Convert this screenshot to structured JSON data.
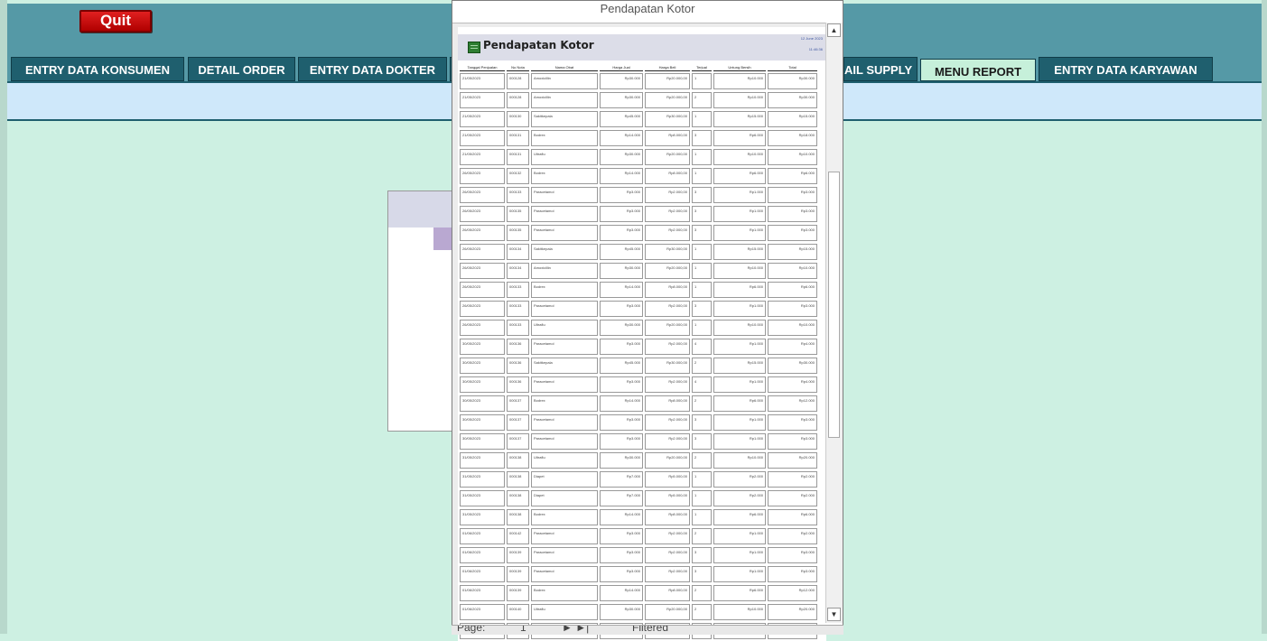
{
  "main": {
    "quit_label": "Quit",
    "tabs": [
      {
        "label": "ENTRY DATA KONSUMEN",
        "active": false
      },
      {
        "label": "DETAIL ORDER",
        "active": false
      },
      {
        "label": "ENTRY DATA DOKTER",
        "active": false
      },
      {
        "label": "",
        "active": false
      },
      {
        "label": "AIL SUPPLY",
        "active": false
      },
      {
        "label": "MENU REPORT",
        "active": true
      },
      {
        "label": "ENTRY DATA KARYAWAN",
        "active": false
      }
    ]
  },
  "report_window": {
    "title": "Pendapatan Kotor",
    "report_title": "Pendapatan Kotor",
    "date": "12 June 2023",
    "time": "11:46:36",
    "columns": [
      "Tanggal Penjualan",
      "No Nota",
      "Nama Obat",
      "Harga Jual",
      "Harga Beli",
      "Terjual",
      "Untung Bersih",
      "Total"
    ],
    "rows": [
      [
        "21/05/2023",
        "000128",
        "Amoxicillin",
        "Rp30.000",
        "Rp20.000,00",
        "1",
        "Rp10.000",
        "Rp30.000"
      ],
      [
        "21/05/2023",
        "000128",
        "Amoxicillin",
        "Rp30.000",
        "Rp20.000,00",
        "2",
        "Rp10.000",
        "Rp30.000"
      ],
      [
        "21/05/2023",
        "000130",
        "Sakitkepala",
        "Rp45.000",
        "Rp30.000,00",
        "1",
        "Rp15.000",
        "Rp15.000"
      ],
      [
        "21/05/2023",
        "000131",
        "Bodrex",
        "Rp14.000",
        "Rp8.000,00",
        "3",
        "Rp6.000",
        "Rp18.000"
      ],
      [
        "21/05/2023",
        "000131",
        "Ultraflu",
        "Rp30.000",
        "Rp20.000,00",
        "1",
        "Rp10.000",
        "Rp10.000"
      ],
      [
        "26/05/2023",
        "000132",
        "Bodrex",
        "Rp14.000",
        "Rp8.000,00",
        "1",
        "Rp6.000",
        "Rp6.000"
      ],
      [
        "26/05/2023",
        "000133",
        "Paracetamol",
        "Rp3.000",
        "Rp2.000,00",
        "3",
        "Rp1.000",
        "Rp3.000"
      ],
      [
        "26/05/2023",
        "000135",
        "Paracetamol",
        "Rp3.000",
        "Rp2.000,00",
        "3",
        "Rp1.000",
        "Rp3.000"
      ],
      [
        "26/05/2023",
        "000135",
        "Paracetamol",
        "Rp3.000",
        "Rp2.000,00",
        "3",
        "Rp1.000",
        "Rp3.000"
      ],
      [
        "26/05/2023",
        "000134",
        "Sakitkepala",
        "Rp45.000",
        "Rp30.000,00",
        "1",
        "Rp15.000",
        "Rp15.000"
      ],
      [
        "26/05/2023",
        "000134",
        "Amoxicillin",
        "Rp30.000",
        "Rp20.000,00",
        "1",
        "Rp10.000",
        "Rp10.000"
      ],
      [
        "26/05/2023",
        "000133",
        "Bodrex",
        "Rp14.000",
        "Rp8.000,00",
        "1",
        "Rp6.000",
        "Rp6.000"
      ],
      [
        "26/05/2023",
        "000133",
        "Paracetamol",
        "Rp3.000",
        "Rp2.000,00",
        "3",
        "Rp1.000",
        "Rp3.000"
      ],
      [
        "26/05/2023",
        "000133",
        "Ultraflu",
        "Rp30.000",
        "Rp20.000,00",
        "1",
        "Rp10.000",
        "Rp10.000"
      ],
      [
        "30/05/2023",
        "000136",
        "Paracetamol",
        "Rp3.000",
        "Rp2.000,00",
        "4",
        "Rp1.000",
        "Rp4.000"
      ],
      [
        "30/05/2023",
        "000136",
        "Sakitkepala",
        "Rp45.000",
        "Rp30.000,00",
        "2",
        "Rp15.000",
        "Rp30.000"
      ],
      [
        "30/05/2023",
        "000136",
        "Paracetamol",
        "Rp3.000",
        "Rp2.000,00",
        "4",
        "Rp1.000",
        "Rp4.000"
      ],
      [
        "30/05/2023",
        "000137",
        "Bodrex",
        "Rp14.000",
        "Rp8.000,00",
        "2",
        "Rp6.000",
        "Rp12.000"
      ],
      [
        "30/05/2023",
        "000137",
        "Paracetamol",
        "Rp3.000",
        "Rp2.000,00",
        "3",
        "Rp1.000",
        "Rp3.000"
      ],
      [
        "30/05/2023",
        "000137",
        "Paracetamol",
        "Rp3.000",
        "Rp2.000,00",
        "3",
        "Rp1.000",
        "Rp3.000"
      ],
      [
        "31/05/2023",
        "000138",
        "Ultraflu",
        "Rp30.000",
        "Rp20.000,00",
        "2",
        "Rp10.000",
        "Rp20.000"
      ],
      [
        "31/05/2023",
        "000138",
        "Diapet",
        "Rp7.000",
        "Rp5.000,00",
        "1",
        "Rp2.000",
        "Rp2.000"
      ],
      [
        "31/05/2023",
        "000138",
        "Diapet",
        "Rp7.000",
        "Rp5.000,00",
        "1",
        "Rp2.000",
        "Rp2.000"
      ],
      [
        "31/05/2023",
        "000138",
        "Bodrex",
        "Rp14.000",
        "Rp8.000,00",
        "1",
        "Rp6.000",
        "Rp6.000"
      ],
      [
        "01/06/2023",
        "000142",
        "Paracetamol",
        "Rp3.000",
        "Rp2.000,00",
        "2",
        "Rp1.000",
        "Rp2.000"
      ],
      [
        "01/06/2023",
        "000139",
        "Paracetamol",
        "Rp3.000",
        "Rp2.000,00",
        "3",
        "Rp1.000",
        "Rp3.000"
      ],
      [
        "01/06/2023",
        "000139",
        "Paracetamol",
        "Rp3.000",
        "Rp2.000,00",
        "3",
        "Rp1.000",
        "Rp3.000"
      ],
      [
        "01/06/2023",
        "000139",
        "Bodrex",
        "Rp14.000",
        "Rp8.000,00",
        "2",
        "Rp6.000",
        "Rp12.000"
      ],
      [
        "01/06/2023",
        "000140",
        "Ultraflu",
        "Rp30.000",
        "Rp20.000,00",
        "2",
        "Rp10.000",
        "Rp20.000"
      ],
      [
        "01/06/2023",
        "000141",
        "Amoxicillin",
        "Rp30.000",
        "Rp20.000,00",
        "2",
        "Rp10.000",
        "Rp20.000"
      ]
    ]
  },
  "nav_bar": {
    "page_label": "Page:",
    "page_value": "1",
    "filter_label": "Filtered"
  }
}
